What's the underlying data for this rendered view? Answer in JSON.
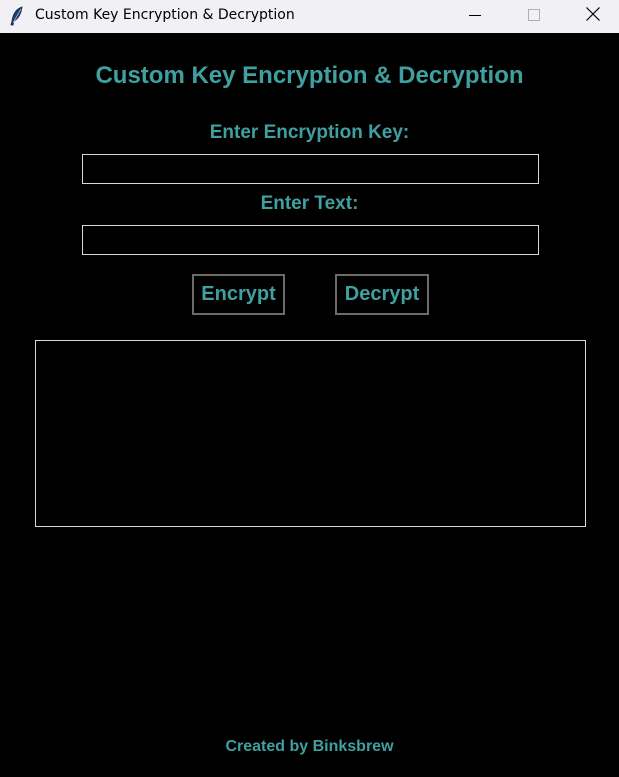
{
  "window": {
    "title": "Custom Key Encryption & Decryption",
    "icon": "feather-icon",
    "controls": [
      "minimize-icon",
      "maximize-icon",
      "close-icon"
    ]
  },
  "main": {
    "heading": "Custom Key Encryption & Decryption",
    "key_label": "Enter Encryption Key:",
    "key_value": "",
    "text_label": "Enter Text:",
    "text_value": "",
    "encrypt_label": "Encrypt",
    "decrypt_label": "Decrypt",
    "output_value": ""
  },
  "footer": {
    "credit": "Created by Binksbrew"
  },
  "colors": {
    "background": "#000000",
    "accent": "#40a0a0",
    "titlebar": "#f0f0f5",
    "field_border": "#d8d8d8",
    "button_border": "#6b6b6b"
  }
}
